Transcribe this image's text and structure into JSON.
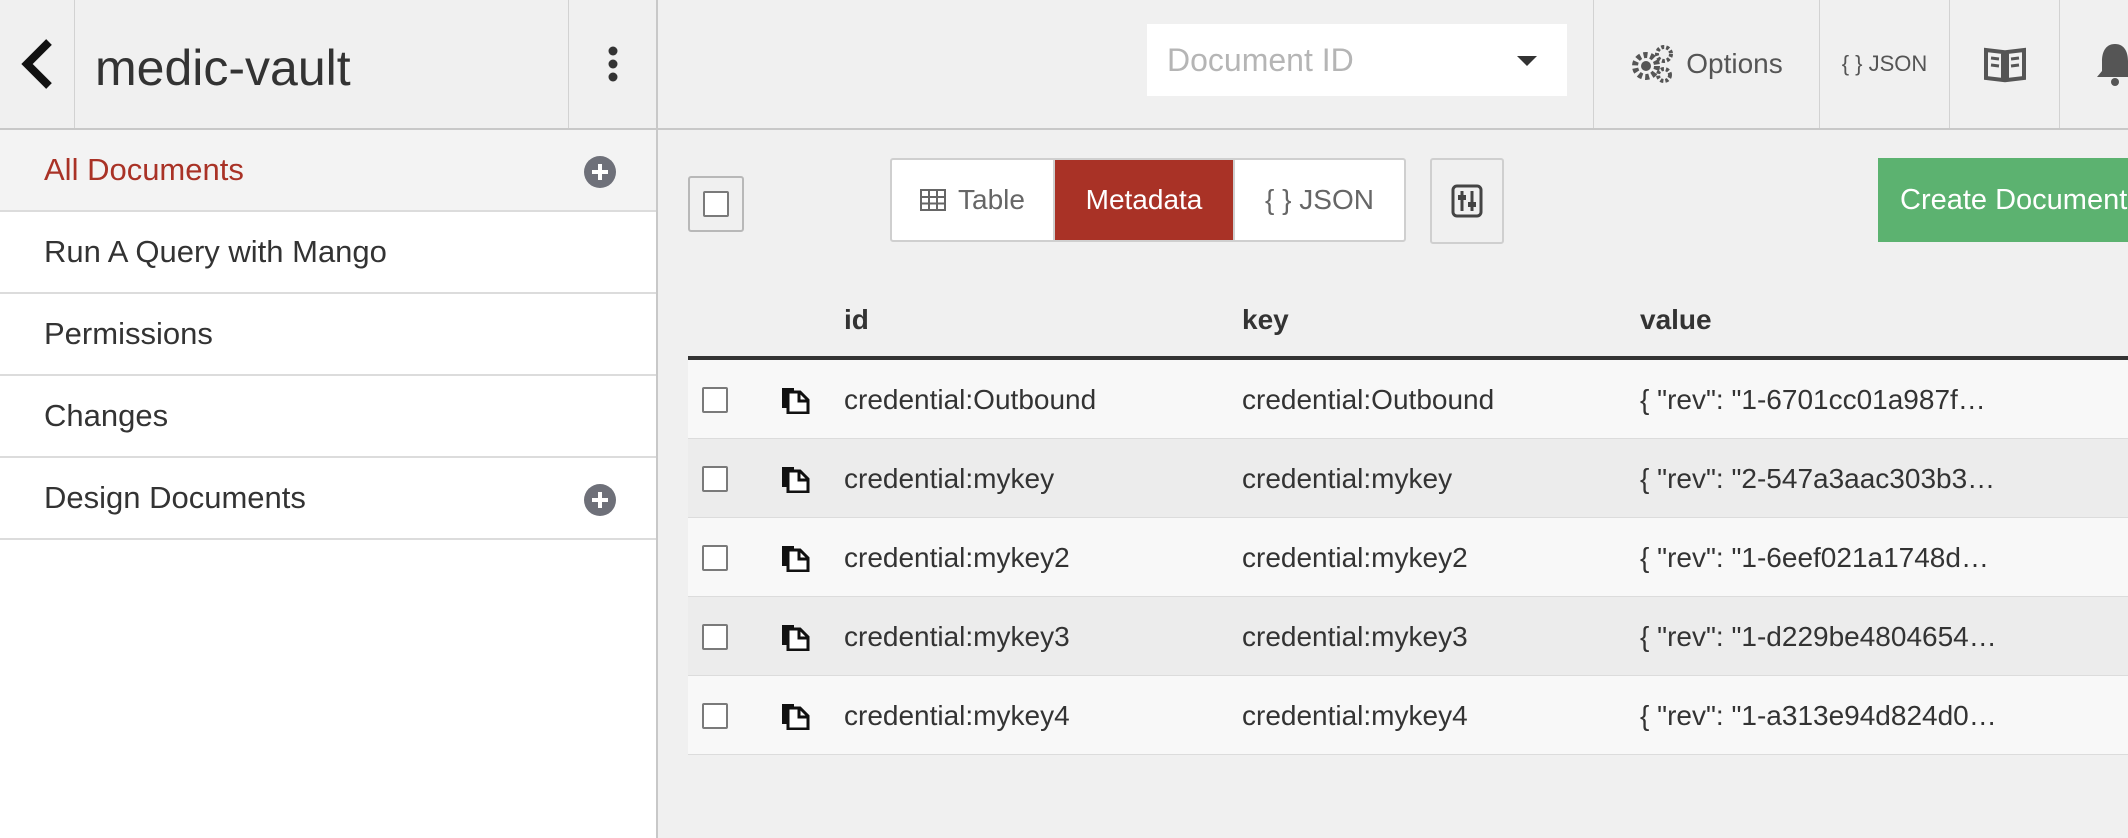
{
  "header": {
    "db_name": "medic-vault",
    "doc_id_placeholder": "Document ID",
    "options_label": "Options",
    "json_label": "{ } JSON"
  },
  "sidebar": {
    "items": [
      {
        "label": "All Documents",
        "active": true,
        "has_add": true
      },
      {
        "label": "Run A Query with Mango"
      },
      {
        "label": "Permissions"
      },
      {
        "label": "Changes"
      },
      {
        "label": "Design Documents",
        "has_add": true
      }
    ]
  },
  "toolbar": {
    "view_modes": [
      "Table",
      "Metadata",
      "{ } JSON"
    ],
    "active_view": "Metadata",
    "create_label": "Create Document"
  },
  "table": {
    "columns": [
      "id",
      "key",
      "value"
    ],
    "rows": [
      {
        "id": "credential:Outbound",
        "key": "credential:Outbound",
        "value": "{ \"rev\": \"1-6701cc01a987f…"
      },
      {
        "id": "credential:mykey",
        "key": "credential:mykey",
        "value": "{ \"rev\": \"2-547a3aac303b3…"
      },
      {
        "id": "credential:mykey2",
        "key": "credential:mykey2",
        "value": "{ \"rev\": \"1-6eef021a1748d…"
      },
      {
        "id": "credential:mykey3",
        "key": "credential:mykey3",
        "value": "{ \"rev\": \"1-d229be4804654…"
      },
      {
        "id": "credential:mykey4",
        "key": "credential:mykey4",
        "value": "{ \"rev\": \"1-a313e94d824d0…"
      }
    ]
  },
  "colors": {
    "accent": "#a93226",
    "create_button": "#5cb270",
    "header_bg": "#f0f0f0"
  },
  "icons": {
    "back": "chevron-left-icon",
    "menu": "kebab-menu-icon",
    "options": "gears-icon",
    "docs": "book-icon",
    "notifications": "bell-icon",
    "table_view": "table-grid-icon",
    "settings": "sliders-icon",
    "document": "document-icon"
  }
}
